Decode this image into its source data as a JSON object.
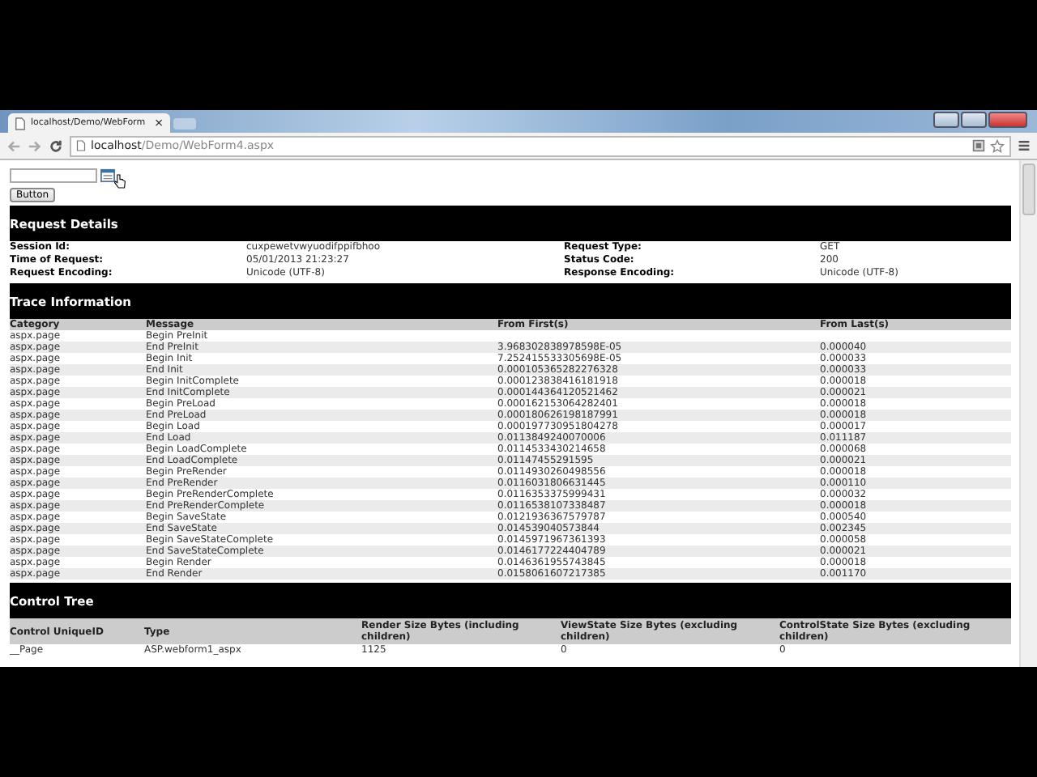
{
  "browser": {
    "tab_title": "localhost/Demo/WebForm",
    "tab_close": "×",
    "url_host": "localhost",
    "url_path": "/Demo/WebForm4.aspx"
  },
  "form": {
    "button": "Button"
  },
  "request_details": {
    "title": "Request Details",
    "fields": [
      {
        "label": "Session Id:",
        "value": "cuxpewetvwyuodifppifbhoo",
        "label2": "Request Type:",
        "value2": "GET"
      },
      {
        "label": "Time of Request:",
        "value": "05/01/2013 21:23:27",
        "label2": "Status Code:",
        "value2": "200"
      },
      {
        "label": "Request Encoding:",
        "value": "Unicode (UTF-8)",
        "label2": "Response Encoding:",
        "value2": "Unicode (UTF-8)"
      }
    ]
  },
  "trace": {
    "title": "Trace Information",
    "columns": [
      "Category",
      "Message",
      "From First(s)",
      "From Last(s)"
    ],
    "rows": [
      [
        "aspx.page",
        "Begin PreInit",
        "",
        ""
      ],
      [
        "aspx.page",
        "End PreInit",
        "3.968302838978598E-05",
        "0.000040"
      ],
      [
        "aspx.page",
        "Begin Init",
        "7.252415533305698E-05",
        "0.000033"
      ],
      [
        "aspx.page",
        "End Init",
        "0.000105365282276328",
        "0.000033"
      ],
      [
        "aspx.page",
        "Begin InitComplete",
        "0.000123838416181918",
        "0.000018"
      ],
      [
        "aspx.page",
        "End InitComplete",
        "0.000144364120521462",
        "0.000021"
      ],
      [
        "aspx.page",
        "Begin PreLoad",
        "0.000162153064282401",
        "0.000018"
      ],
      [
        "aspx.page",
        "End PreLoad",
        "0.000180626198187991",
        "0.000018"
      ],
      [
        "aspx.page",
        "Begin Load",
        "0.000197730951804278",
        "0.000017"
      ],
      [
        "aspx.page",
        "End Load",
        "0.0113849240070006",
        "0.011187"
      ],
      [
        "aspx.page",
        "Begin LoadComplete",
        "0.0114533430214658",
        "0.000068"
      ],
      [
        "aspx.page",
        "End LoadComplete",
        "0.01147455291595",
        "0.000021"
      ],
      [
        "aspx.page",
        "Begin PreRender",
        "0.0114930260498556",
        "0.000018"
      ],
      [
        "aspx.page",
        "End PreRender",
        "0.0116031806631445",
        "0.000110"
      ],
      [
        "aspx.page",
        "Begin PreRenderComplete",
        "0.0116353375999431",
        "0.000032"
      ],
      [
        "aspx.page",
        "End PreRenderComplete",
        "0.0116538107338487",
        "0.000018"
      ],
      [
        "aspx.page",
        "Begin SaveState",
        "0.0121936367579787",
        "0.000540"
      ],
      [
        "aspx.page",
        "End SaveState",
        "0.014539040573844",
        "0.002345"
      ],
      [
        "aspx.page",
        "Begin SaveStateComplete",
        "0.0145971967361393",
        "0.000058"
      ],
      [
        "aspx.page",
        "End SaveStateComplete",
        "0.0146177224404789",
        "0.000021"
      ],
      [
        "aspx.page",
        "Begin Render",
        "0.0146361955743845",
        "0.000018"
      ],
      [
        "aspx.page",
        "End Render",
        "0.0158061607217385",
        "0.001170"
      ]
    ]
  },
  "control_tree": {
    "title": "Control Tree",
    "columns": [
      "Control UniqueID",
      "Type",
      "Render Size Bytes (including children)",
      "ViewState Size Bytes (excluding children)",
      "ControlState Size Bytes (excluding children)"
    ],
    "rows": [
      [
        "__Page",
        "ASP.webform1_aspx",
        "1125",
        "0",
        "0"
      ]
    ]
  }
}
